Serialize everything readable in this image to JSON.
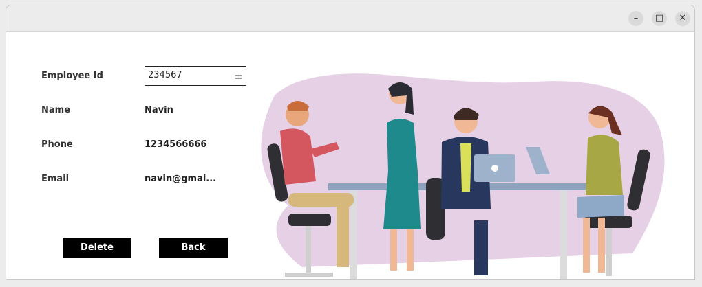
{
  "window": {
    "minimize_label": "–",
    "maximize_label": "□",
    "close_label": "✕"
  },
  "form": {
    "employee_id": {
      "label": "Employee Id",
      "value": "234567"
    },
    "name": {
      "label": "Name",
      "value": "Navin"
    },
    "phone": {
      "label": "Phone",
      "value": "1234566666"
    },
    "email": {
      "label": "Email",
      "value": "navin@gmai..."
    }
  },
  "buttons": {
    "delete_label": "Delete",
    "back_label": "Back"
  },
  "colors": {
    "button_bg": "#000000",
    "blob": "#e6d0e6",
    "table": "#8fa3bf"
  },
  "illustration": {
    "icon": "office-team-meeting-illustration"
  }
}
